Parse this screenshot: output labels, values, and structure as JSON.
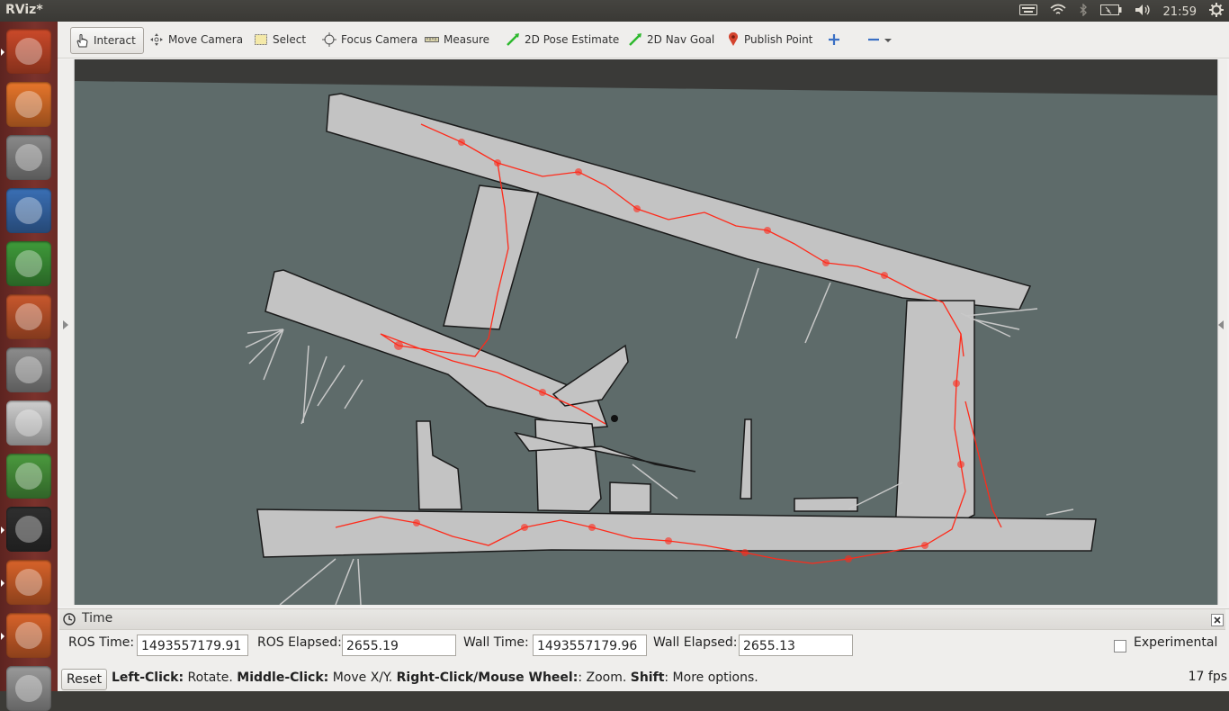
{
  "window": {
    "title": "RViz*"
  },
  "tray": {
    "clock": "21:59"
  },
  "launcher": {
    "items": [
      {
        "name": "ubuntu-dash-icon",
        "color": "#cc4a2a"
      },
      {
        "name": "firefox-icon",
        "color": "#e8762b"
      },
      {
        "name": "files-icon",
        "color": "#8a8a8a"
      },
      {
        "name": "writer-icon",
        "color": "#3a6fb5"
      },
      {
        "name": "calc-icon",
        "color": "#3f9b3a"
      },
      {
        "name": "impress-icon",
        "color": "#c9582d"
      },
      {
        "name": "system-settings-icon",
        "color": "#8d8d8d"
      },
      {
        "name": "text-editor-icon",
        "color": "#cfcfcf"
      },
      {
        "name": "software-updater-icon",
        "color": "#4b9a3e"
      },
      {
        "name": "terminal-icon",
        "color": "#2f2f2f"
      },
      {
        "name": "matlab-icon",
        "color": "#d8632a"
      },
      {
        "name": "matlab-icon-2",
        "color": "#d8632a"
      },
      {
        "name": "rviz-icon",
        "color": "#9a9a9a"
      }
    ]
  },
  "toolbar": {
    "tools": [
      {
        "label": "Interact",
        "icon": "hand-icon"
      },
      {
        "label": "Move Camera",
        "icon": "move-camera-icon"
      },
      {
        "label": "Select",
        "icon": "select-icon"
      },
      {
        "label": "Focus Camera",
        "icon": "focus-camera-icon"
      },
      {
        "label": "Measure",
        "icon": "measure-icon"
      },
      {
        "label": "2D Pose Estimate",
        "icon": "pose-estimate-icon"
      },
      {
        "label": "2D Nav Goal",
        "icon": "nav-goal-icon"
      },
      {
        "label": "Publish Point",
        "icon": "publish-point-icon"
      }
    ]
  },
  "time_panel": {
    "title": "Time",
    "ros_time_label": "ROS Time:",
    "ros_time": "1493557179.91",
    "ros_elapsed_label": "ROS Elapsed:",
    "ros_elapsed": "2655.19",
    "wall_time_label": "Wall Time:",
    "wall_time": "1493557179.96",
    "wall_elapsed_label": "Wall Elapsed:",
    "wall_elapsed": "2655.13",
    "experimental_label": "Experimental"
  },
  "status": {
    "reset_label": "Reset",
    "help": {
      "b1": "Left-Click:",
      "t1": " Rotate. ",
      "b2": "Middle-Click:",
      "t2": " Move X/Y. ",
      "b3": "Right-Click/Mouse Wheel:",
      "t3": ": Zoom. ",
      "b4": "Shift",
      "t4": ": More options."
    },
    "fps": "17 fps"
  },
  "colors": {
    "map_free": "#c3c3c3",
    "map_unknown": "#5e6b6a",
    "trajectory": "#ff2a1a",
    "launcher_bg": "#6b2a25"
  }
}
